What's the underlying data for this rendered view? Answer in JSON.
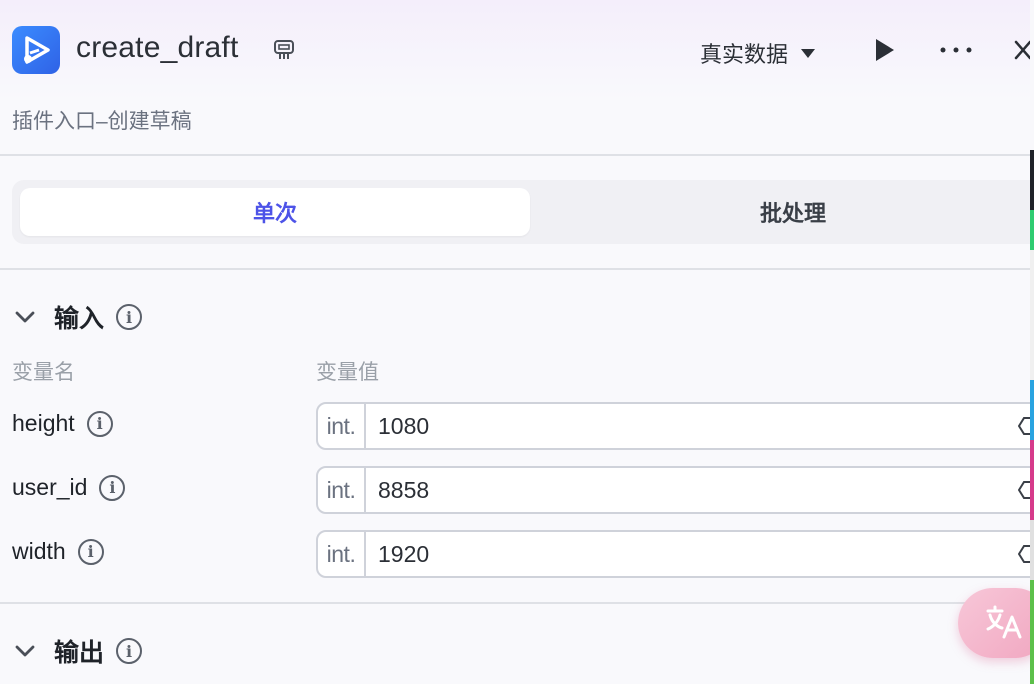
{
  "header": {
    "title": "create_draft",
    "mode_label": "真实数据",
    "subtitle": "插件入口–创建草稿"
  },
  "tabs": [
    {
      "label": "单次",
      "active": true
    },
    {
      "label": "批处理",
      "active": false
    }
  ],
  "input_section": {
    "title": "输入",
    "col_name": "变量名",
    "col_value": "变量值",
    "variables": [
      {
        "name": "height",
        "type": "int.",
        "value": "1080"
      },
      {
        "name": "user_id",
        "type": "int.",
        "value": "8858"
      },
      {
        "name": "width",
        "type": "int.",
        "value": "1920"
      }
    ]
  },
  "output_section": {
    "title": "输出"
  },
  "colors": {
    "accent": "#4d53e8",
    "app_icon": "#2f62e6",
    "fab": "#f1a6c0"
  },
  "icons": {
    "app": "video-play-app-icon",
    "badge": "plugin-badge-icon",
    "dropdown": "caret-down-icon",
    "run": "play-icon",
    "more": "ellipsis-icon",
    "close": "close-icon",
    "info": "info-icon",
    "collapse": "chevron-down-icon",
    "translate": "translate-icon"
  }
}
